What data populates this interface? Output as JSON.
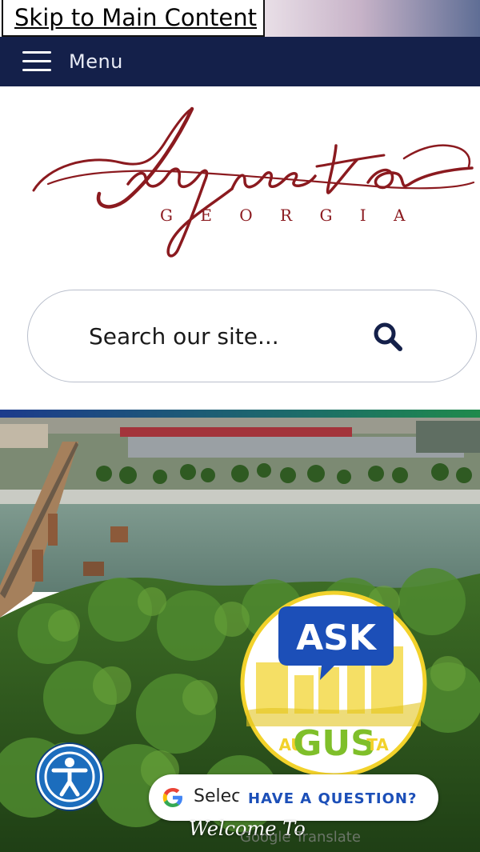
{
  "skip_link": {
    "label": "Skip to Main Content"
  },
  "nav": {
    "menu_label": "Menu",
    "menu_icon": "hamburger-icon"
  },
  "logo": {
    "wordmark": "Augusta",
    "subtitle": "G E O R G I A",
    "color": "#8b1a1f"
  },
  "search": {
    "placeholder": "Search our site...",
    "icon": "search-icon"
  },
  "colors": {
    "navbar": "#14204a",
    "accent_blue": "#1c4fb8",
    "gus_yellow": "#f2d22b",
    "gus_green": "#7fbf2a"
  },
  "ask_gus": {
    "ask_label": "ASK",
    "gus_label": "GUS",
    "au_label": "AU",
    "ta_label": "TA"
  },
  "translate": {
    "select_label": "Selec",
    "google_ghost": "Google Translate"
  },
  "question_button": {
    "label": "HAVE A QUESTION?"
  },
  "hero": {
    "welcome_text": "Welcome To"
  },
  "accessibility": {
    "icon": "accessibility-person-icon"
  }
}
